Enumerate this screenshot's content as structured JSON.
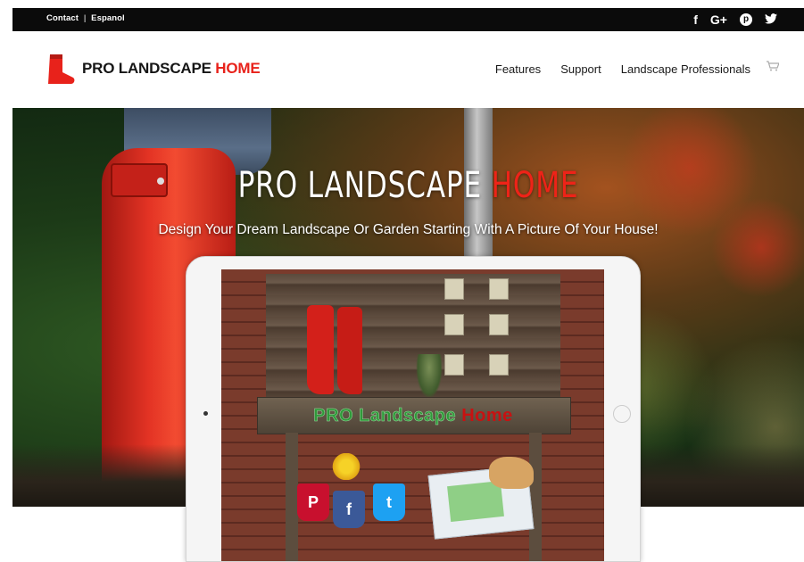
{
  "topbar": {
    "contact_label": "Contact",
    "separator": "|",
    "espanol_label": "Espanol",
    "social": [
      {
        "name": "facebook-icon",
        "glyph": "f"
      },
      {
        "name": "google-plus-icon",
        "glyph": "G+"
      },
      {
        "name": "pinterest-icon",
        "glyph": "p"
      },
      {
        "name": "twitter-icon",
        "glyph": "🐦"
      }
    ]
  },
  "header": {
    "logo_black": "PRO LANDSCAPE",
    "logo_red": "HOME",
    "nav": [
      "Features",
      "Support",
      "Landscape Professionals"
    ],
    "cart_icon": "cart-icon"
  },
  "hero": {
    "title_white": "PRO LANDSCAPE",
    "title_red": "HOME",
    "subtitle": "Design Your Dream Landscape Or Garden Starting With A Picture Of Your House!",
    "tablet_brand_green": "PRO Landscape",
    "tablet_brand_red": "Home",
    "pots": [
      {
        "name": "pinterest-pot",
        "glyph": "P",
        "color": "#c8102e"
      },
      {
        "name": "facebook-pot",
        "glyph": "f",
        "color": "#3b5998"
      },
      {
        "name": "twitter-pot",
        "glyph": "t",
        "color": "#1da1f2"
      }
    ]
  },
  "colors": {
    "brand_red": "#e8221b",
    "topbar_bg": "#0b0b0b"
  }
}
